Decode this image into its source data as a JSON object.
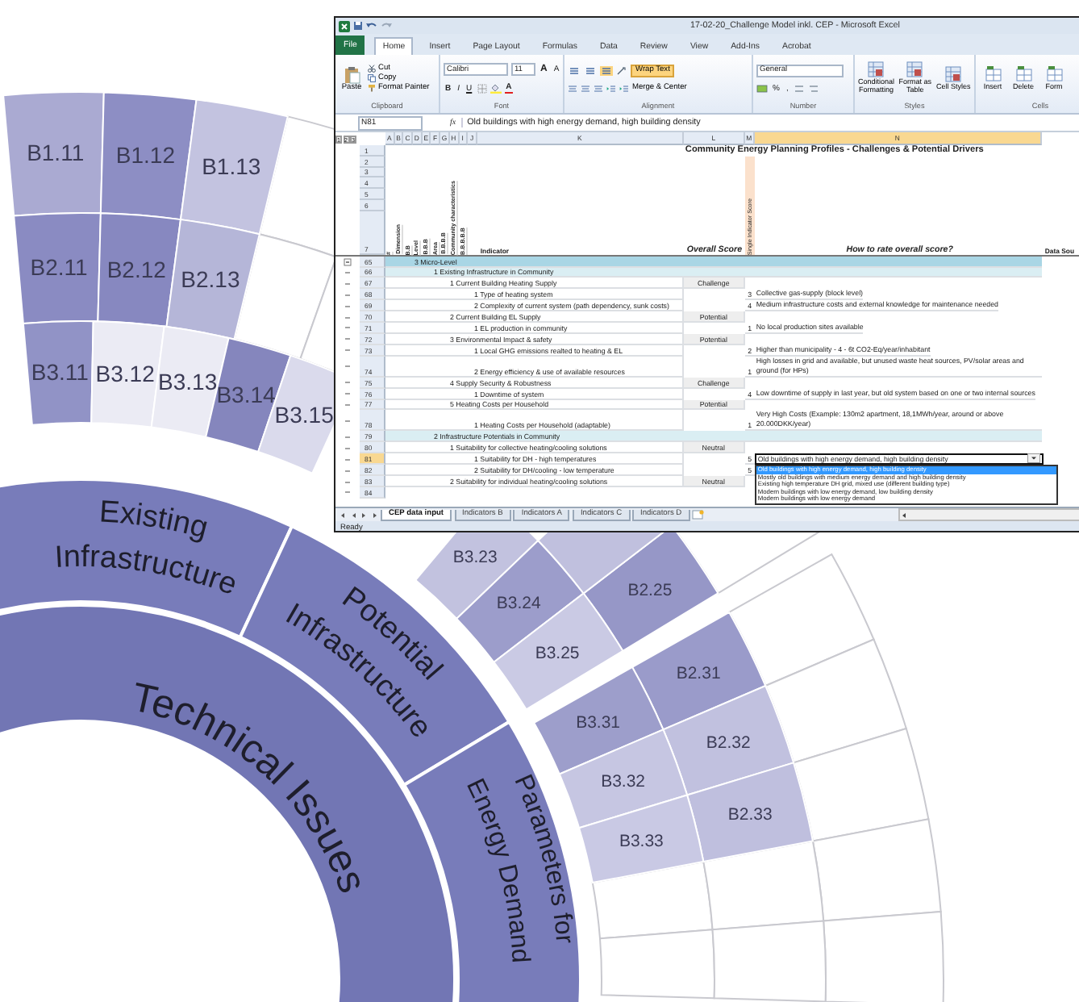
{
  "diagram": {
    "core": {
      "label": "Technical Issues"
    },
    "categories": [
      {
        "lines": [
          "Existing",
          "Infrastructure"
        ]
      },
      {
        "lines": [
          "Potential",
          "Infrastructure"
        ]
      },
      {
        "lines": [
          "Parameters for",
          "Energy Demand"
        ]
      }
    ],
    "cells": [
      {
        "label": "B1.11",
        "color": "#aaaad2"
      },
      {
        "label": "B1.12",
        "color": "#8d8ec4"
      },
      {
        "label": "B1.13",
        "color": "#c3c3e0"
      },
      {
        "label": "B2.11",
        "color": "#8a8bc2"
      },
      {
        "label": "B2.12",
        "color": "#8788c0"
      },
      {
        "label": "B2.13",
        "color": "#b5b6d8"
      },
      {
        "label": "B3.11",
        "color": "#9193c6"
      },
      {
        "label": "B3.12",
        "color": "#ebebf4"
      },
      {
        "label": "B3.13",
        "color": "#ebebf4"
      },
      {
        "label": "B3.14",
        "color": "#8586bd"
      },
      {
        "label": "B3.15",
        "color": "#dadaec"
      },
      {
        "label": "B3.23",
        "color": "#c2c2df"
      },
      {
        "label": "B3.24",
        "color": "#9c9dcb"
      },
      {
        "label": "B2.25",
        "color": "#9697c7"
      },
      {
        "label": "B3.25",
        "color": "#cacae4"
      },
      {
        "color": "#c0c0de"
      },
      {
        "label": "B2.31",
        "color": "#9a9bca"
      },
      {
        "label": "B3.31",
        "color": "#9d9ecb"
      },
      {
        "label": "B2.32",
        "color": "#c1c1df"
      },
      {
        "label": "B3.32",
        "color": "#c6c6e2"
      },
      {
        "label": "B2.33",
        "color": "#bfbfde"
      },
      {
        "label": "B3.33",
        "color": "#c9c9e4"
      }
    ]
  },
  "excel": {
    "title": "17-02-20_Challenge Model inkl. CEP - Microsoft Excel",
    "ribbon_tabs": [
      {
        "label": "File",
        "kind": "file",
        "selected": false
      },
      {
        "label": "Home",
        "kind": "tab",
        "selected": true
      },
      {
        "label": "Insert",
        "kind": "tab",
        "selected": false
      },
      {
        "label": "Page Layout",
        "kind": "tab",
        "selected": false
      },
      {
        "label": "Formulas",
        "kind": "tab",
        "selected": false
      },
      {
        "label": "Data",
        "kind": "tab",
        "selected": false
      },
      {
        "label": "Review",
        "kind": "tab",
        "selected": false
      },
      {
        "label": "View",
        "kind": "tab",
        "selected": false
      },
      {
        "label": "Add-Ins",
        "kind": "tab",
        "selected": false
      },
      {
        "label": "Acrobat",
        "kind": "tab",
        "selected": false
      }
    ],
    "ribbon": {
      "clipboard": {
        "paste": "Paste",
        "cut": "Cut",
        "copy": "Copy",
        "format_painter": "Format Painter",
        "label": "Clipboard"
      },
      "font": {
        "family": "Calibri",
        "size": "11",
        "grow": "A",
        "shrink": "A",
        "bold": "B",
        "italic": "I",
        "underline": "U",
        "font_color_letter": "A",
        "label": "Font"
      },
      "alignment": {
        "buttons": [
          {
            "selected": false
          },
          {
            "selected": false
          },
          {
            "selected": true
          }
        ],
        "wrap_text": {
          "label": "Wrap Text",
          "selected": true
        },
        "merge": "Merge & Center",
        "label": "Alignment"
      },
      "number": {
        "format": "General",
        "percent": "%",
        "comma": ",",
        "label": "Number"
      },
      "styles": {
        "buttons": [
          "Conditional Formatting",
          "Format as Table",
          "Cell Styles"
        ],
        "label": "Styles"
      },
      "cells": {
        "buttons": [
          "Insert",
          "Delete",
          "Form"
        ],
        "label": "Cells"
      }
    },
    "formula_bar": {
      "name_box": "N81",
      "fx": "fx",
      "formula": "Old buildings with high energy demand, high building density"
    },
    "sheet": {
      "outline_levels": [
        "1",
        "2",
        "3"
      ],
      "columns": [
        {
          "label": "A",
          "selected": false
        },
        {
          "label": "B",
          "selected": false
        },
        {
          "label": "C",
          "selected": false
        },
        {
          "label": "D",
          "selected": false
        },
        {
          "label": "E",
          "selected": false
        },
        {
          "label": "F",
          "selected": false
        },
        {
          "label": "G",
          "selected": false
        },
        {
          "label": "H",
          "selected": false
        },
        {
          "label": "I",
          "selected": false
        },
        {
          "label": "J",
          "selected": false
        },
        {
          "label": "K",
          "selected": false
        },
        {
          "label": "L",
          "selected": false
        },
        {
          "label": "M",
          "selected": false
        },
        {
          "label": "N",
          "selected": true
        }
      ],
      "top_rows": [
        {
          "row": "1",
          "title": "Community Energy Planning Profiles - Challenges & Potential Drivers"
        },
        {
          "row": "2"
        },
        {
          "row": "3"
        },
        {
          "row": "4"
        },
        {
          "row": "5"
        },
        {
          "row": "6"
        }
      ],
      "header_row": {
        "row": "7",
        "rotated": [
          "#",
          "Dimension",
          "B.B",
          "Level",
          "B.B.B",
          "Area",
          "B.B.B.B",
          "Community characteristics",
          "B.B.B.B.B"
        ],
        "indicator": "Indicator",
        "overall": "Overall Score",
        "single": "Single Indicator Score",
        "rating": "How to rate overall score?",
        "source": "Data Sou"
      },
      "rows": [
        {
          "row": "65",
          "text": "3 Micro-Level",
          "selected": false,
          "children": [
            {
              "row": "66",
              "text": "1 Existing Infrastructure in Community",
              "selected": false,
              "children": [
                {
                  "row": "67",
                  "text": "1 Current Building Heating Supply",
                  "score": "Challenge",
                  "selected": false,
                  "children": [
                    {
                      "row": "68",
                      "text": "1 Type of heating system",
                      "value": "3",
                      "rating": "Collective gas-supply (block level)",
                      "selected": false
                    },
                    {
                      "row": "69",
                      "text": "2 Complexity of current system (path dependency, sunk costs)",
                      "value": "4",
                      "rating": "Medium infrastructure costs and external knowledge for maintenance needed",
                      "selected": false
                    }
                  ]
                },
                {
                  "row": "70",
                  "text": "2 Current Building EL Supply",
                  "score": "Potential",
                  "selected": false,
                  "children": [
                    {
                      "row": "71",
                      "text": "1 EL production in community",
                      "value": "1",
                      "rating": "No local production sites available",
                      "selected": false
                    }
                  ]
                },
                {
                  "row": "72",
                  "text": "3 Environmental Impact & safety",
                  "score": "Potential",
                  "selected": false,
                  "children": [
                    {
                      "row": "73",
                      "text": "1 Local GHG emissions realted to heating & EL",
                      "value": "2",
                      "rating": "Higher than municipality - 4 - 6t CO2-Eq/year/inhabitant",
                      "selected": false
                    },
                    {
                      "row": "74",
                      "text": "2 Energy efficiency & use of available resources",
                      "value": "1",
                      "rating": "High losses in grid and available, but unused waste heat sources, PV/solar areas and ground (for HPs)",
                      "selected": false
                    }
                  ]
                },
                {
                  "row": "75",
                  "text": "4 Supply Security & Robustness",
                  "score": "Challenge",
                  "selected": false,
                  "children": [
                    {
                      "row": "76",
                      "text": "1 Downtime of system",
                      "value": "4",
                      "rating": "Low downtime of supply in last year, but old system based on one or two internal sources",
                      "selected": false
                    }
                  ]
                },
                {
                  "row": "77",
                  "text": "5 Heating Costs per Household",
                  "score": "Potential",
                  "selected": false,
                  "children": [
                    {
                      "row": "78",
                      "text": "1 Heating Costs per Household (adaptable)",
                      "value": "1",
                      "rating": "Very High Costs (Example: 130m2 apartment, 18,1MWh/year, around or above 20.000DKK/year)",
                      "selected": false
                    }
                  ]
                }
              ]
            },
            {
              "row": "79",
              "text": "2 Infrastructure Potentials in Community",
              "selected": false,
              "children": [
                {
                  "row": "80",
                  "text": "1 Suitability for collective heating/cooling solutions",
                  "score": "Neutral",
                  "selected": false,
                  "children": [
                    {
                      "row": "81",
                      "text": "1 Suitability for DH - high temperatures",
                      "value": "5",
                      "rating": "Old buildings with high energy demand, high building density",
                      "selected": true
                    },
                    {
                      "row": "82",
                      "text": "2 Suitability for DH/cooling - low temperature",
                      "value": "5",
                      "selected": false
                    }
                  ]
                },
                {
                  "row": "83",
                  "text": "2 Suitability for individual heating/cooling solutions",
                  "score": "Neutral",
                  "selected": false,
                  "children": [
                    {
                      "row": "84",
                      "selected": false
                    }
                  ]
                }
              ]
            }
          ]
        }
      ],
      "dropdown": {
        "items": [
          {
            "label": "Old buildings with high energy demand, high building density",
            "selected": true
          },
          {
            "label": "Mostly old buildings with medium energy demand and high building density",
            "selected": false
          },
          {
            "label": "Existing high temperature DH grid, mixed use (different building type)",
            "selected": false
          },
          {
            "label": "Modern buildings with low energy demand, low building density",
            "selected": false
          },
          {
            "label": "Modern buildings with low energy demand",
            "selected": false
          }
        ]
      }
    },
    "sheet_tabs": [
      {
        "label": "CEP data input",
        "selected": true
      },
      {
        "label": "Indicators B",
        "selected": false
      },
      {
        "label": "Indicators A",
        "selected": false
      },
      {
        "label": "Indicators C",
        "selected": false
      },
      {
        "label": "Indicators D",
        "selected": false
      }
    ],
    "status": "Ready"
  }
}
